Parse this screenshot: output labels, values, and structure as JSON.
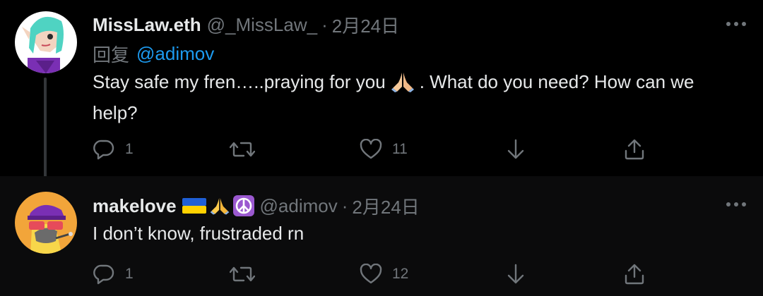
{
  "colors": {
    "background": "#000000",
    "text": "#e7e9ea",
    "muted": "#71767b",
    "accent": "#1d9bf0",
    "thread_line": "#333639"
  },
  "tweets": [
    {
      "name": "MissLaw.eth",
      "handle": "@_MissLaw_",
      "separator": "·",
      "date": "2月24日",
      "reply_prefix": "回复",
      "reply_mention": "@adimov",
      "text_before_emoji": "Stay safe my fren…..praying for you",
      "inline_emoji": "folded-hands-emoji",
      "text_after_emoji": ".  What do you need?  How can we help?",
      "actions": {
        "reply_count": "1",
        "like_count": "11"
      },
      "avatar": "elf-avatar"
    },
    {
      "name": "makelove",
      "name_emojis": [
        "ukraine-flag-emoji",
        "folded-hands-emoji",
        "peace-symbol-emoji"
      ],
      "handle": "@adimov",
      "separator": "·",
      "date": "2月24日",
      "text": "I don’t know, frustraded rn",
      "actions": {
        "reply_count": "1",
        "like_count": "12"
      },
      "avatar": "cat-avatar"
    }
  ],
  "icons": {
    "more": "more-icon",
    "reply": "reply-icon",
    "retweet": "retweet-icon",
    "like": "like-icon",
    "downvote": "downvote-icon",
    "share": "share-icon"
  }
}
